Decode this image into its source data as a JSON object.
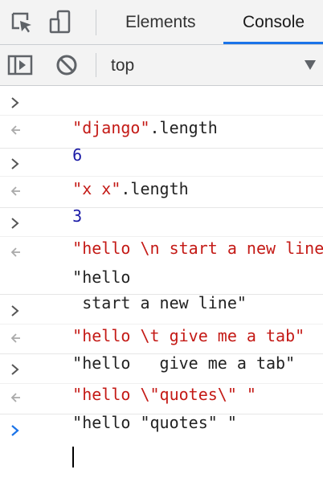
{
  "tabs": {
    "inspect_icon": "inspect-element-icon",
    "device_icon": "device-toggle-icon",
    "elements_label": "Elements",
    "console_label": "Console",
    "active": "Console",
    "accent_color": "#1a73e8"
  },
  "toolbar": {
    "sidebar_icon": "sidebar-toggle-icon",
    "clear_icon": "clear-console-icon",
    "context": "top"
  },
  "entries": [
    {
      "input": [
        "\"django\"",
        ".length"
      ],
      "output": "6"
    },
    {
      "input": [
        "\"x x\"",
        ".length"
      ],
      "output": "3"
    },
    {
      "input": [
        "\"hello \\n start a new line\""
      ],
      "output_lines": [
        "\"hello",
        " start a new line\""
      ]
    },
    {
      "input": [
        "\"hello \\t give me a tab\""
      ],
      "output": "\"hello   give me a tab\""
    },
    {
      "input": [
        "\"hello \\\"quotes\\\" \""
      ],
      "output": "\"hello \"quotes\" \""
    }
  ],
  "colors": {
    "string": "#c41a16",
    "number": "#1a1aa6",
    "prompt": "#1a73e8"
  }
}
